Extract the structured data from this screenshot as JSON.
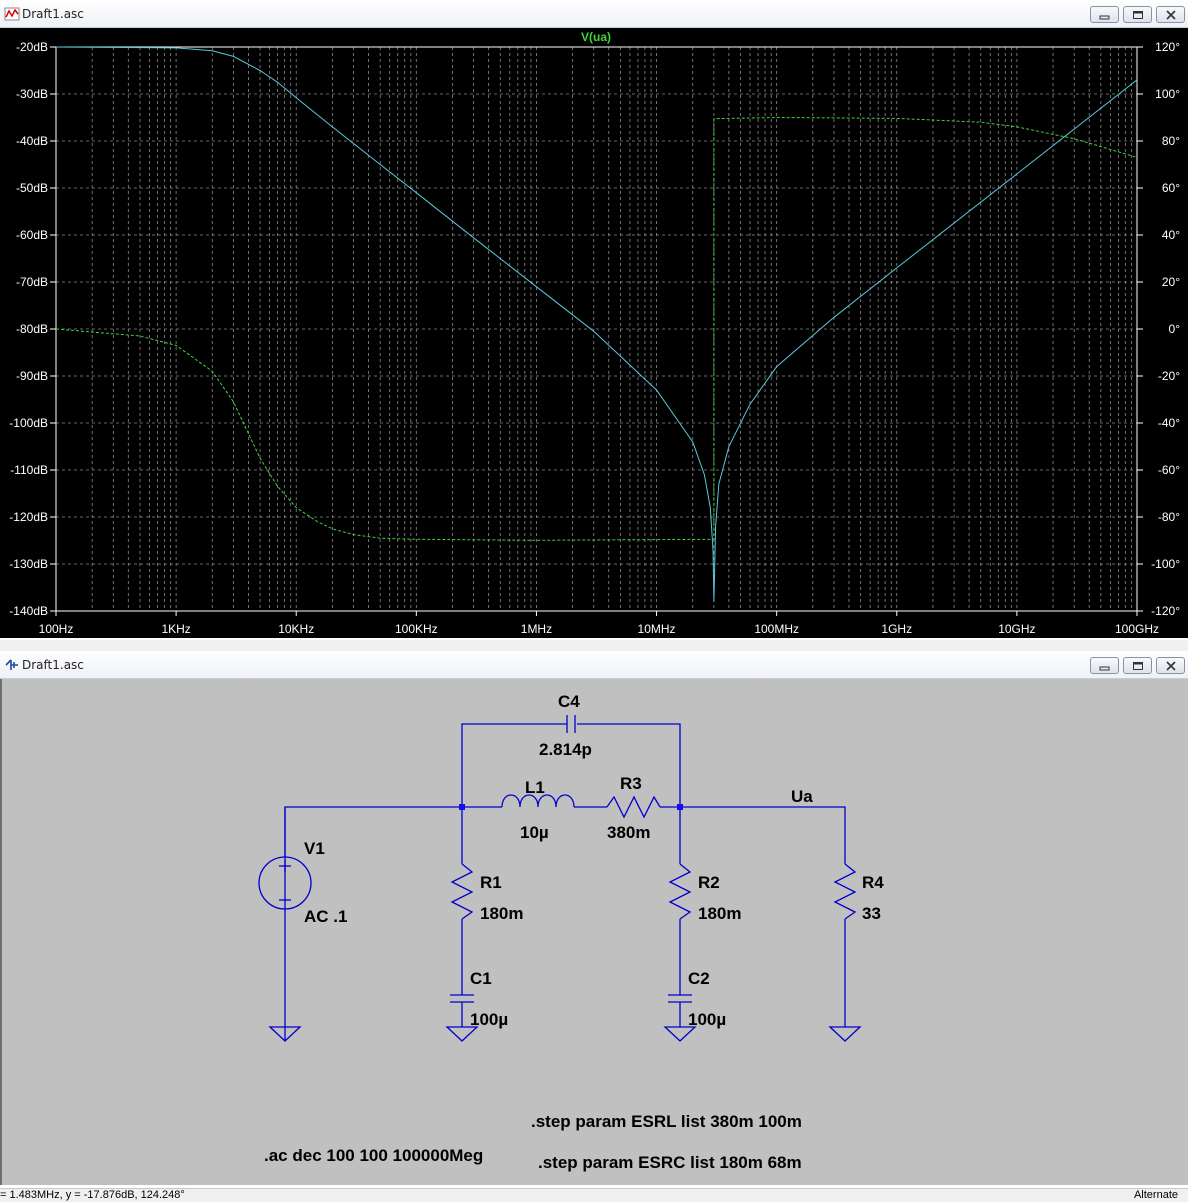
{
  "top_window": {
    "title": "Draft1.asc",
    "controls": [
      "minimize",
      "restore",
      "close"
    ]
  },
  "bottom_window": {
    "title": "Draft1.asc",
    "controls": [
      "minimize",
      "restore",
      "close"
    ]
  },
  "chart_data": {
    "type": "line",
    "title": "V(ua)",
    "x_scale": "log",
    "xlim": [
      100,
      100000000000
    ],
    "x_tick_labels": [
      "100Hz",
      "1KHz",
      "10KHz",
      "100KHz",
      "1MHz",
      "10MHz",
      "100MHz",
      "1GHz",
      "10GHz",
      "100GHz"
    ],
    "ylim_left": [
      -140,
      -20
    ],
    "y_left_tick_labels": [
      "-20dB",
      "-30dB",
      "-40dB",
      "-50dB",
      "-60dB",
      "-70dB",
      "-80dB",
      "-90dB",
      "-100dB",
      "-110dB",
      "-120dB",
      "-130dB",
      "-140dB"
    ],
    "ylim_right": [
      -120,
      120
    ],
    "y_right_tick_labels": [
      "120°",
      "100°",
      "80°",
      "60°",
      "40°",
      "20°",
      "0°",
      "-20°",
      "-40°",
      "-60°",
      "-80°",
      "-100°",
      "-120°"
    ],
    "grid": true,
    "colors": {
      "background": "#000000",
      "magnitude": "#5ac8dc",
      "phase": "#3ed43e",
      "axis": "#ffffff",
      "title": "#3ed43e"
    },
    "series": [
      {
        "name": "V(ua)",
        "kind": "magnitude_db",
        "style": "solid",
        "x": [
          100,
          1000,
          2000,
          3000,
          5000,
          7000,
          10000,
          20000,
          50000,
          100000,
          300000,
          1000000,
          3000000,
          10000000,
          20000000,
          25000000,
          28000000,
          29500000,
          30000000,
          31000000,
          33000000,
          40000000,
          60000000,
          100000000,
          300000000,
          1000000000,
          10000000000,
          100000000000
        ],
        "y": [
          -20,
          -20.2,
          -20.8,
          -22,
          -25,
          -27.5,
          -30.8,
          -37,
          -45,
          -51,
          -60.6,
          -71,
          -80.5,
          -93,
          -104,
          -111,
          -118,
          -127,
          -138,
          -122,
          -113,
          -105,
          -96,
          -88,
          -77.5,
          -67,
          -47,
          -27
        ]
      },
      {
        "name": "V(ua)",
        "kind": "phase_deg",
        "style": "dashed",
        "x": [
          100,
          500,
          1000,
          2000,
          3000,
          5000,
          7000,
          10000,
          15000,
          20000,
          30000,
          50000,
          100000,
          1000000,
          10000000,
          29999000,
          30001000,
          100000000,
          1000000000,
          5000000000,
          10000000000,
          30000000000,
          100000000000
        ],
        "y": [
          0,
          -3,
          -7,
          -18,
          -31,
          -55,
          -67,
          -76,
          -82,
          -85,
          -87.5,
          -89,
          -89.5,
          -89.9,
          -89.6,
          -89.5,
          89.5,
          90,
          89.6,
          88,
          86,
          81,
          73
        ]
      }
    ]
  },
  "schematic": {
    "components": {
      "c4": {
        "name": "C4",
        "value": "2.814p"
      },
      "l1": {
        "name": "L1",
        "value": "10µ"
      },
      "r3": {
        "name": "R3",
        "value": "380m"
      },
      "v1": {
        "name": "V1",
        "value": "AC .1"
      },
      "r1": {
        "name": "R1",
        "value": "180m"
      },
      "r2": {
        "name": "R2",
        "value": "180m"
      },
      "r4": {
        "name": "R4",
        "value": "33"
      },
      "c1": {
        "name": "C1",
        "value": "100µ"
      },
      "c2": {
        "name": "C2",
        "value": "100µ"
      }
    },
    "net_label": "Ua",
    "directives": {
      "step_esrl": ".step param ESRL list 380m 100m",
      "step_esrc": ".step param ESRC list 180m 68m",
      "ac": ".ac dec 100 100 100000Meg"
    },
    "colors": {
      "background": "#c0c0c0",
      "wire": "#0000cc",
      "junction": "#1010ee",
      "text": "#000000"
    }
  },
  "status_bar": {
    "cursor_readout": "= 1.483MHz,  y = -17.876dB, 124.248°",
    "mode": "Alternate"
  }
}
